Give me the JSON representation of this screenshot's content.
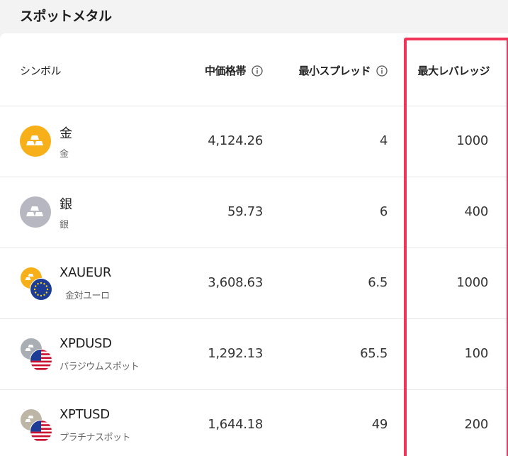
{
  "section": {
    "title": "スポットメタル"
  },
  "table": {
    "headers": {
      "symbol": "シンボル",
      "mid_price": "中価格帯",
      "min_spread": "最小スプレッド",
      "max_leverage": "最大レバレッジ"
    },
    "rows": [
      {
        "name": "金",
        "sub": "金",
        "mid": "4,124.26",
        "spread": "4",
        "leverage": "1000",
        "icon": "gold-bar-icon"
      },
      {
        "name": "銀",
        "sub": "銀",
        "mid": "59.73",
        "spread": "6",
        "leverage": "400",
        "icon": "silver-bar-icon"
      },
      {
        "name": "XAUEUR",
        "sub": "金対ユーロ",
        "mid": "3,608.63",
        "spread": "6.5",
        "leverage": "1000",
        "icon": "gold-eu-flag-icon"
      },
      {
        "name": "XPDUSD",
        "sub": "パラジウムスポット",
        "mid": "1,292.13",
        "spread": "65.5",
        "leverage": "100",
        "icon": "palladium-us-flag-icon"
      },
      {
        "name": "XPTUSD",
        "sub": "プラチナスポット",
        "mid": "1,644.18",
        "spread": "49",
        "leverage": "200",
        "icon": "platinum-us-flag-icon"
      }
    ]
  },
  "colors": {
    "gold": "#f7b019",
    "silver": "#b7b7c2",
    "palladium": "#a9aeb5",
    "platinum": "#bdb6a6",
    "highlight": "#f0345a",
    "eu_blue": "#1c3c96",
    "eu_star": "#ffd200"
  }
}
